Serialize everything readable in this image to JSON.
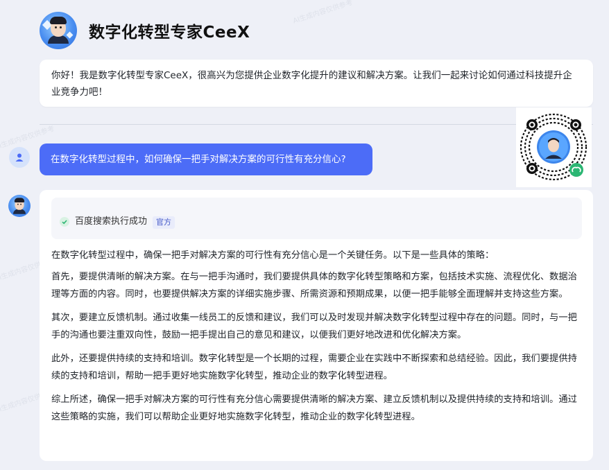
{
  "header": {
    "title": "数字化转型专家CeeX"
  },
  "greeting": {
    "text": "你好！我是数字化转型专家CeeX，很高兴为您提供企业数字化提升的建议和解决方案。让我们一起来讨论如何通过科技提升企业竞争力吧！"
  },
  "user_message": {
    "text": "在数字化转型过程中，如何确保一把手对解决方案的可行性有充分信心?"
  },
  "search_status": {
    "label": "百度搜索执行成功",
    "badge": "官方"
  },
  "answer": {
    "paragraphs": [
      "在数字化转型过程中，确保一把手对解决方案的可行性有充分信心是一个关键任务。以下是一些具体的策略：",
      "首先，要提供清晰的解决方案。在与一把手沟通时，我们要提供具体的数字化转型策略和方案，包括技术实施、流程优化、数据治理等方面的内容。同时，也要提供解决方案的详细实施步骤、所需资源和预期成果，以便一把手能够全面理解并支持这些方案。",
      "其次，要建立反馈机制。通过收集一线员工的反馈和建议，我们可以及时发现并解决数字化转型过程中存在的问题。同时，与一把手的沟通也要注重双向性，鼓励一把手提出自己的意见和建议，以便我们更好地改进和优化解决方案。",
      "此外，还要提供持续的支持和培训。数字化转型是一个长期的过程，需要企业在实践中不断探索和总结经验。因此，我们要提供持续的支持和培训，帮助一把手更好地实施数字化转型，推动企业的数字化转型进程。",
      "综上所述，确保一把手对解决方案的可行性有充分信心需要提供清晰的解决方案、建立反馈机制以及提供持续的支持和培训。通过这些策略的实施，我们可以帮助企业更好地实施数字化转型，推动企业的数字化转型进程。"
    ]
  },
  "watermark_text": "AI生成内容仅供参考",
  "icons": {
    "user_avatar": "user-icon",
    "check": "check-icon",
    "qr": "qr-code-icon",
    "miniprogram": "mini-program-icon"
  },
  "colors": {
    "accent": "#4c6cf7",
    "background": "#eef0f7",
    "success": "#2bb673"
  }
}
